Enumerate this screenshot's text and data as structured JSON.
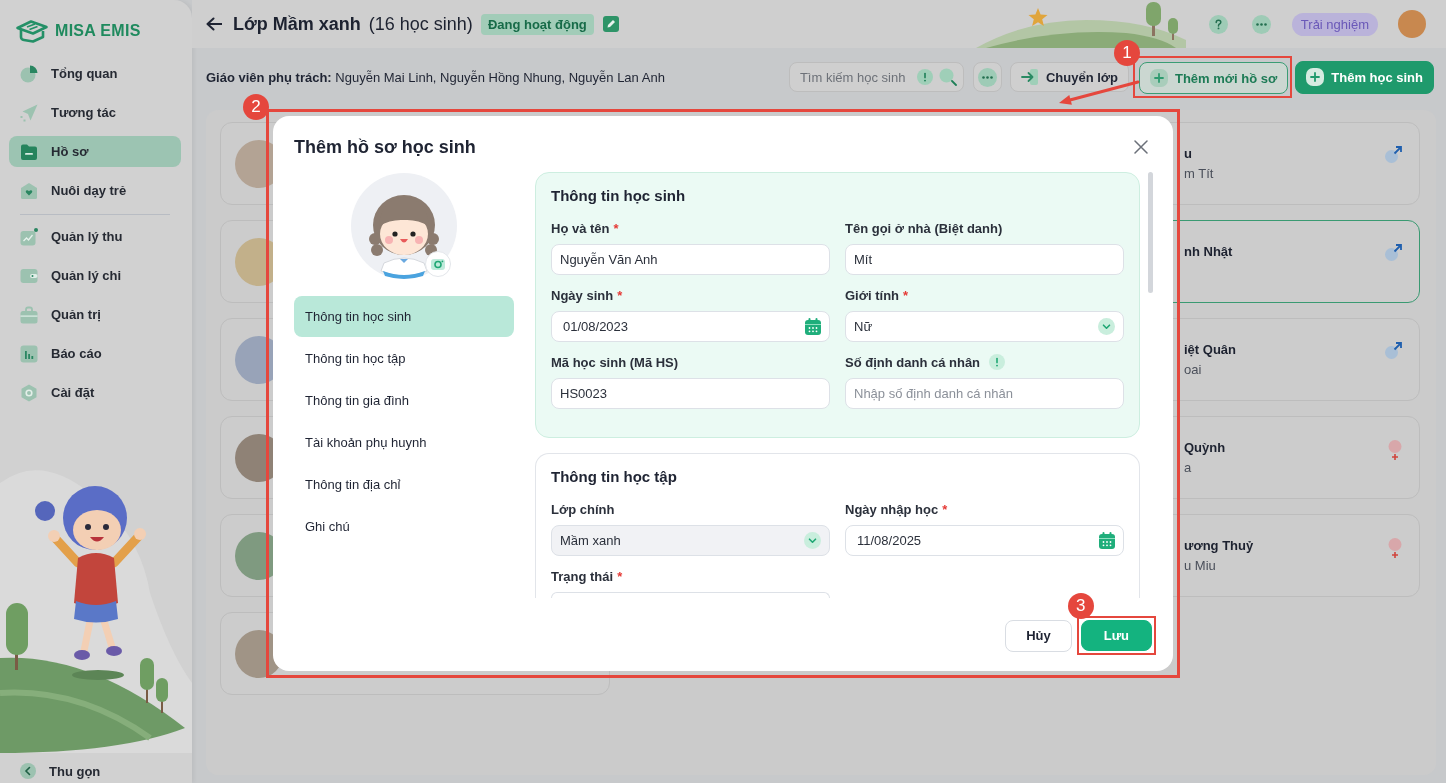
{
  "sidebar": {
    "logo": "MISA EMIS",
    "groups": [
      {
        "items": [
          {
            "label": "Tổng quan",
            "selected": false
          },
          {
            "label": "Tương tác",
            "selected": false
          },
          {
            "label": "Hồ sơ",
            "selected": true
          },
          {
            "label": "Nuôi dạy trẻ",
            "selected": false
          }
        ]
      },
      {
        "items": [
          {
            "label": "Quản lý thu",
            "selected": false
          },
          {
            "label": "Quản lý chi",
            "selected": false
          },
          {
            "label": "Quản trị",
            "selected": false
          },
          {
            "label": "Báo cáo",
            "selected": false
          },
          {
            "label": "Cài đặt",
            "selected": false
          }
        ]
      }
    ],
    "collapse": "Thu gọn"
  },
  "header": {
    "title": "Lớp Mầm xanh",
    "count": "(16 học sinh)",
    "status": "Đang hoạt động",
    "trial": "Trải nghiệm"
  },
  "toolbar": {
    "teachers": "**Giáo viên phụ trách:** Nguyễn Mai Linh, Nguyễn Hồng Nhung, Nguyễn Lan Anh",
    "search": {
      "placeholder": "Tìm kiếm học sinh"
    },
    "buttons": [
      {
        "label": "Chuyển lớp",
        "kind": "secondary"
      },
      {
        "label": "Thêm mới hồ sơ",
        "kind": "outline",
        "annotation": "1"
      },
      {
        "label": "Thêm học sinh",
        "kind": "primary"
      }
    ]
  },
  "student_cards": {
    "column_1": [
      {
        "selected": false
      },
      {
        "selected": false
      },
      {
        "selected": false
      },
      {
        "selected": false
      },
      {
        "selected": false
      },
      {
        "selected": false
      }
    ],
    "column_3": [
      {
        "name": "u",
        "nickname": "m Tít",
        "kind": "male",
        "selected": false
      },
      {
        "name": "nh Nhật",
        "kind": "male",
        "selected": true
      },
      {
        "name": "iệt Quân",
        "nickname": "oai",
        "kind": "male",
        "selected": false
      },
      {
        "name": "Quỳnh",
        "nickname": "a",
        "kind": "female",
        "selected": false
      },
      {
        "name": "ương Thuỷ",
        "nickname": "u Miu",
        "kind": "female",
        "selected": false
      }
    ]
  },
  "modal": {
    "annotation": "2",
    "title": "Thêm hồ sơ học sinh",
    "nav": [
      {
        "label": "Thông tin học sinh",
        "selected": true
      },
      {
        "label": "Thông tin học tập",
        "selected": false
      },
      {
        "label": "Thông tin gia đình",
        "selected": false
      },
      {
        "label": "Tài khoản phụ huynh",
        "selected": false
      },
      {
        "label": "Thông tin địa chỉ",
        "selected": false
      },
      {
        "label": "Ghi chú",
        "selected": false
      }
    ],
    "sections": [
      {
        "title": "Thông tin học sinh",
        "highlighted": true,
        "fields": [
          {
            "label": "Họ và tên",
            "required_mark": "*",
            "kind": "text",
            "value": "Nguyễn Văn Anh",
            "info": false,
            "disabled": false
          },
          {
            "label": "Tên gọi ở nhà (Biệt danh)",
            "kind": "text",
            "value": "Mít",
            "info": false,
            "disabled": false
          },
          {
            "label": "Ngày sinh",
            "required_mark": "*",
            "kind": "date",
            "value": "01/08/2023",
            "info": false,
            "disabled": false
          },
          {
            "label": "Giới tính",
            "required_mark": "*",
            "kind": "select",
            "value": "Nữ",
            "info": false,
            "disabled": false
          },
          {
            "label": "Mã học sinh (Mã HS)",
            "kind": "text",
            "value": "HS0023",
            "info": false,
            "disabled": false
          },
          {
            "label": "Số định danh cá nhân",
            "kind": "text",
            "placeholder": "Nhập số định danh cá nhân",
            "info": true,
            "disabled": false
          }
        ]
      },
      {
        "title": "Thông tin học tập",
        "highlighted": false,
        "fields": [
          {
            "label": "Lớp chính",
            "kind": "select",
            "value": "Mầm xanh",
            "info": false,
            "disabled": true
          },
          {
            "label": "Ngày nhập học",
            "required_mark": "*",
            "kind": "date",
            "value": "11/08/2025",
            "info": false,
            "disabled": false
          },
          {
            "label": "Trạng thái",
            "required_mark": "*",
            "info": false,
            "disabled": false
          }
        ]
      }
    ],
    "buttons": [
      {
        "label": "Hủy",
        "kind": "secondary"
      },
      {
        "label": "Lưu",
        "kind": "primary",
        "annotation": "3"
      }
    ]
  }
}
